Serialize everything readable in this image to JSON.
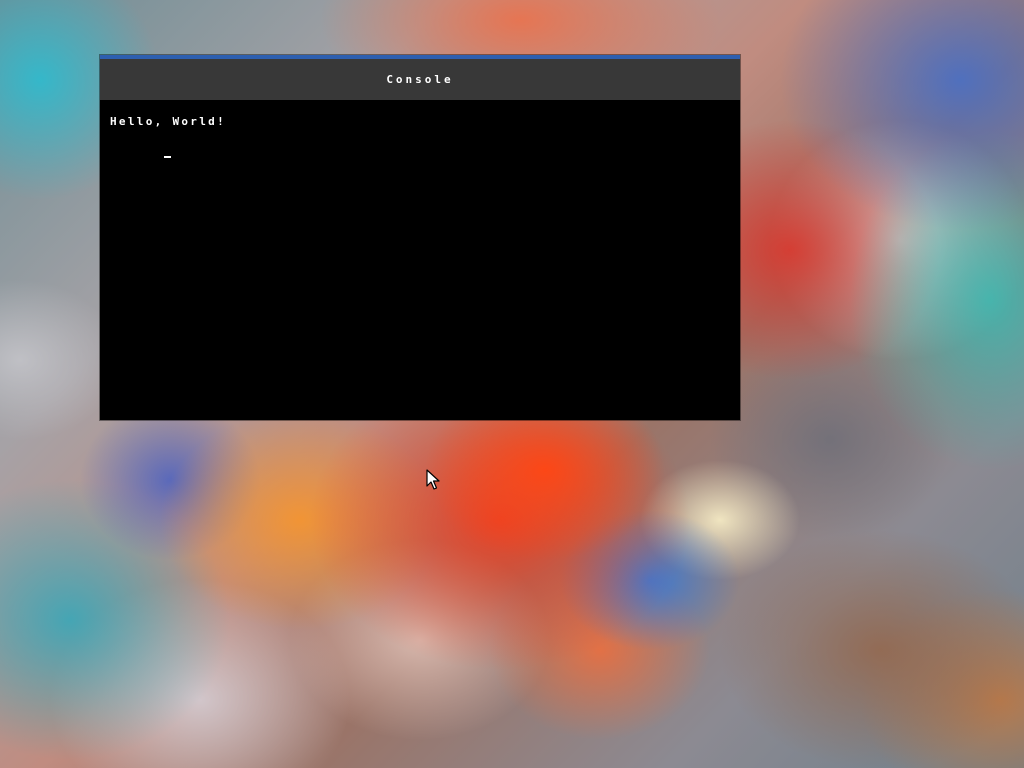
{
  "window": {
    "title": "Console",
    "accent_color": "#2d5fb0",
    "titlebar_color": "#383838",
    "background_color": "#000000"
  },
  "terminal": {
    "lines": [
      "Hello, World!"
    ],
    "cursor": "_"
  },
  "desktop": {
    "wallpaper": "abstract colorful smoke clouds"
  },
  "pointer": {
    "icon": "arrow-cursor-icon"
  }
}
